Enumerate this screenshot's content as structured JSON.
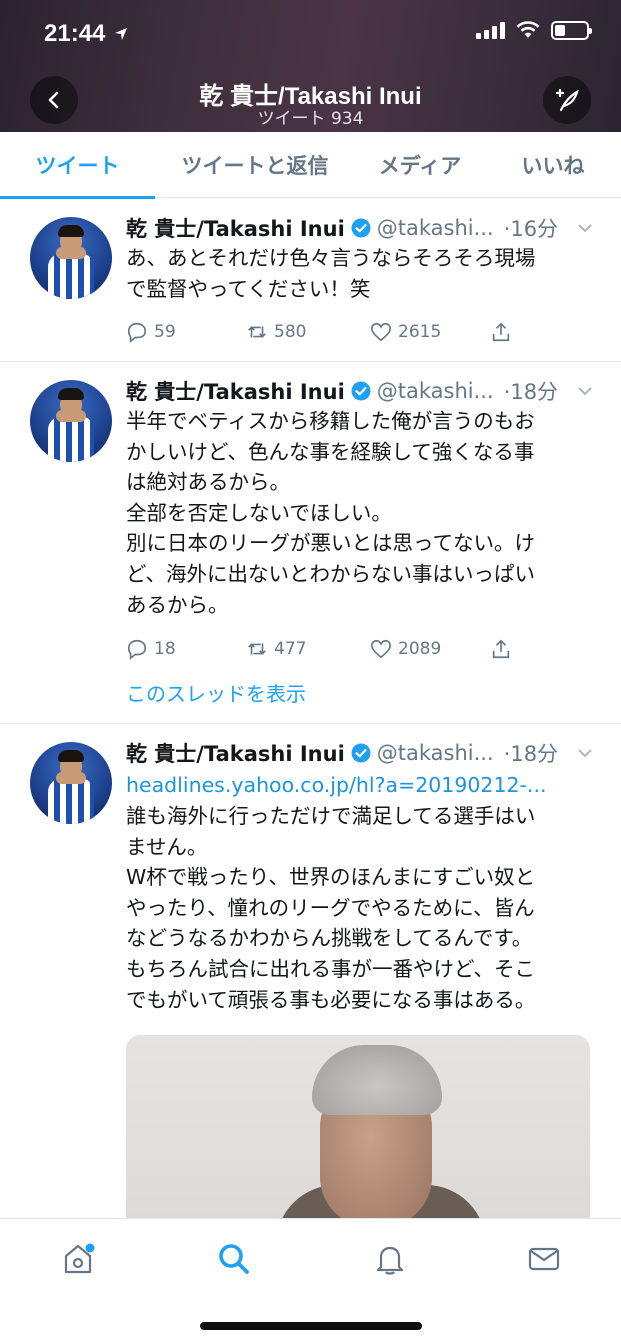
{
  "status_bar": {
    "time": "21:44"
  },
  "header": {
    "title": "乾 貴士/Takashi Inui",
    "subtitle": "ツイート 934"
  },
  "tabs": [
    {
      "label": "ツイート",
      "active": true
    },
    {
      "label": "ツイートと返信",
      "active": false
    },
    {
      "label": "メディア",
      "active": false
    },
    {
      "label": "いいね",
      "active": false
    }
  ],
  "tweets": [
    {
      "name": "乾 貴士/Takashi Inui",
      "handle": "@takashi...",
      "time": "·16分",
      "text": "あ、あとそれだけ色々言うならそろそろ現場\nで監督やってください！笑",
      "replies": "59",
      "retweets": "580",
      "likes": "2615"
    },
    {
      "name": "乾 貴士/Takashi Inui",
      "handle": "@takashi...",
      "time": "·18分",
      "text": "半年でベティスから移籍した俺が言うのもお\nかしいけど、色んな事を経験して強くなる事\nは絶対あるから。\n全部を否定しないでほしい。\n別に日本のリーグが悪いとは思ってない。け\nど、海外に出ないとわからない事はいっぱい\nあるから。",
      "replies": "18",
      "retweets": "477",
      "likes": "2089",
      "thread_label": "このスレッドを表示"
    },
    {
      "name": "乾 貴士/Takashi Inui",
      "handle": "@takashi...",
      "time": "·18分",
      "link": "headlines.yahoo.co.jp/hl?a=20190212-...",
      "text": "誰も海外に行っただけで満足してる選手はい\nません。\nW杯で戦ったり、世界のほんまにすごい奴と\nやったり、憧れのリーグでやるために、皆ん\nなどうなるかわからん挑戦をしてるんです。\nもちろん試合に出れる事が一番やけど、そこ\nでもがいて頑張る事も必要になる事はある。"
    }
  ],
  "colors": {
    "accent": "#1da1f2",
    "muted": "#657786"
  }
}
